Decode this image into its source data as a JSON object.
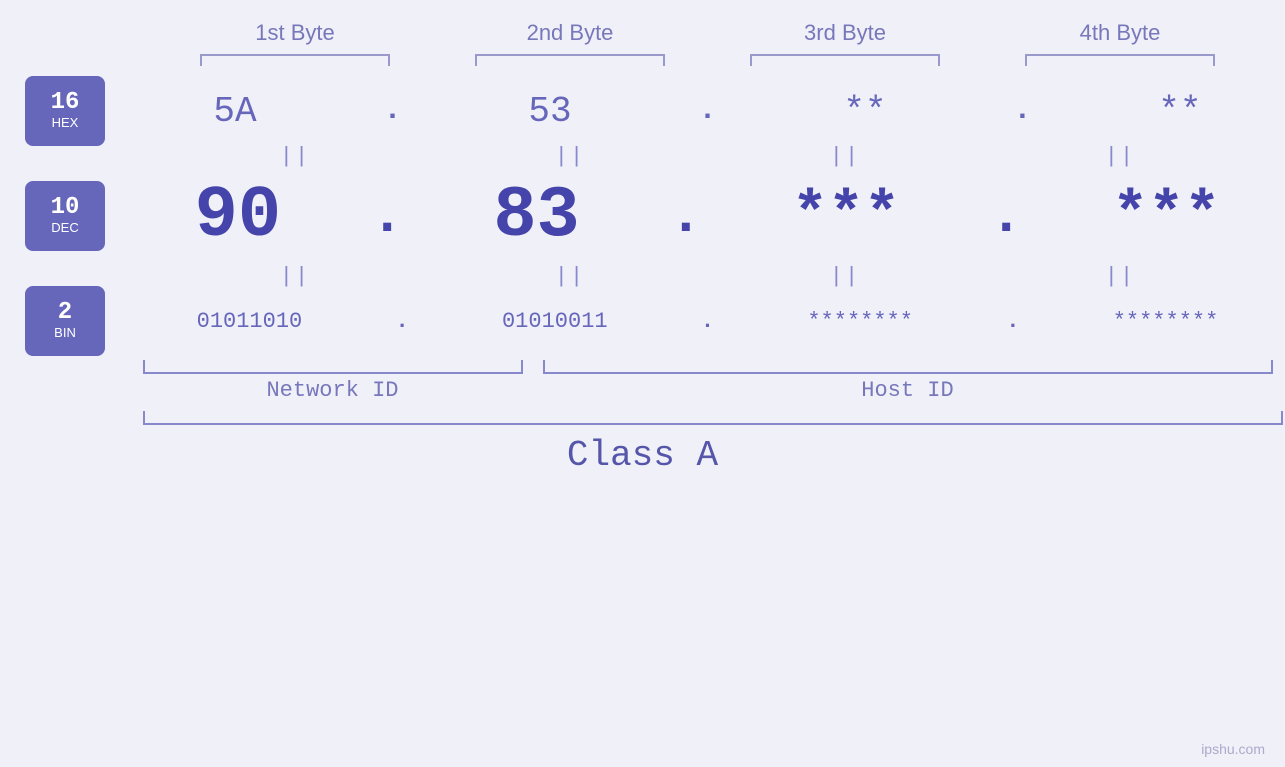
{
  "byteHeaders": [
    "1st Byte",
    "2nd Byte",
    "3rd Byte",
    "4th Byte"
  ],
  "badges": [
    {
      "num": "16",
      "label": "HEX"
    },
    {
      "num": "10",
      "label": "DEC"
    },
    {
      "num": "2",
      "label": "BIN"
    }
  ],
  "hexRow": {
    "values": [
      "5A",
      "53",
      "**",
      "**"
    ],
    "dots": [
      ".",
      ".",
      "."
    ]
  },
  "decRow": {
    "values": [
      "90",
      "83",
      "***",
      "***"
    ],
    "dots": [
      ".",
      ".",
      "."
    ]
  },
  "binRow": {
    "values": [
      "01011010",
      "01010011",
      "********",
      "********"
    ],
    "dots": [
      ".",
      ".",
      "."
    ]
  },
  "separators": [
    "||",
    "||",
    "||",
    "||"
  ],
  "labels": {
    "networkId": "Network ID",
    "hostId": "Host ID",
    "classA": "Class A"
  },
  "watermark": "ipshu.com"
}
